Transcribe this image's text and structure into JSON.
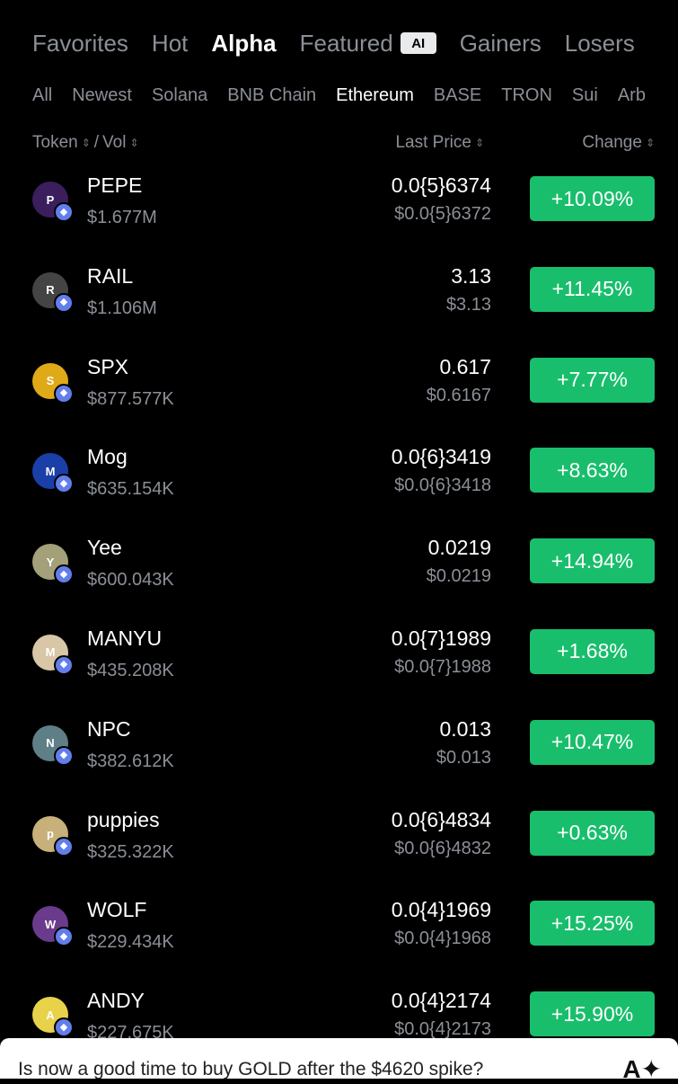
{
  "main_tabs": [
    {
      "label": "Favorites"
    },
    {
      "label": "Hot"
    },
    {
      "label": "Alpha",
      "active": true
    },
    {
      "label": "Featured",
      "badge": "AI"
    },
    {
      "label": "Gainers"
    },
    {
      "label": "Losers"
    }
  ],
  "sub_tabs": [
    {
      "label": "All"
    },
    {
      "label": "Newest"
    },
    {
      "label": "Solana"
    },
    {
      "label": "BNB Chain"
    },
    {
      "label": "Ethereum",
      "active": true
    },
    {
      "label": "BASE"
    },
    {
      "label": "TRON"
    },
    {
      "label": "Sui"
    },
    {
      "label": "Arb"
    }
  ],
  "columns": {
    "token": "Token",
    "separator": "/",
    "vol": "Vol",
    "last_price": "Last Price",
    "change": "Change"
  },
  "tokens": [
    {
      "name": "PEPE",
      "vol": "$1.677M",
      "price": "0.0{5}6374",
      "price_usd": "$0.0{5}6372",
      "change": "+10.09%",
      "logo_color": "#3a1f5c",
      "logo_text": "P"
    },
    {
      "name": "RAIL",
      "vol": "$1.106M",
      "price": "3.13",
      "price_usd": "$3.13",
      "change": "+11.45%",
      "logo_color": "#444444",
      "logo_text": "R"
    },
    {
      "name": "SPX",
      "vol": "$877.577K",
      "price": "0.617",
      "price_usd": "$0.6167",
      "change": "+7.77%",
      "logo_color": "#e0a917",
      "logo_text": "S"
    },
    {
      "name": "Mog",
      "vol": "$635.154K",
      "price": "0.0{6}3419",
      "price_usd": "$0.0{6}3418",
      "change": "+8.63%",
      "logo_color": "#1b3fa8",
      "logo_text": "M"
    },
    {
      "name": "Yee",
      "vol": "$600.043K",
      "price": "0.0219",
      "price_usd": "$0.0219",
      "change": "+14.94%",
      "logo_color": "#a3a07a",
      "logo_text": "Y"
    },
    {
      "name": "MANYU",
      "vol": "$435.208K",
      "price": "0.0{7}1989",
      "price_usd": "$0.0{7}1988",
      "change": "+1.68%",
      "logo_color": "#d8c6a6",
      "logo_text": "M"
    },
    {
      "name": "NPC",
      "vol": "$382.612K",
      "price": "0.013",
      "price_usd": "$0.013",
      "change": "+10.47%",
      "logo_color": "#5f7f86",
      "logo_text": "N"
    },
    {
      "name": "puppies",
      "vol": "$325.322K",
      "price": "0.0{6}4834",
      "price_usd": "$0.0{6}4832",
      "change": "+0.63%",
      "logo_color": "#c7b07a",
      "logo_text": "p"
    },
    {
      "name": "WOLF",
      "vol": "$229.434K",
      "price": "0.0{4}1969",
      "price_usd": "$0.0{4}1968",
      "change": "+15.25%",
      "logo_color": "#6a3b8c",
      "logo_text": "W"
    },
    {
      "name": "ANDY",
      "vol": "$227.675K",
      "price": "0.0{4}2174",
      "price_usd": "$0.0{4}2173",
      "change": "+15.90%",
      "logo_color": "#e8d24a",
      "logo_text": "A"
    }
  ],
  "banner": {
    "question": "Is now a good time to buy GOLD after the $4620 spike?",
    "icon": "ai-sparkle-icon"
  },
  "colors": {
    "background": "#000000",
    "positive": "#19be6c",
    "muted_text": "#8b8f96",
    "ethereum": "#627eea"
  }
}
